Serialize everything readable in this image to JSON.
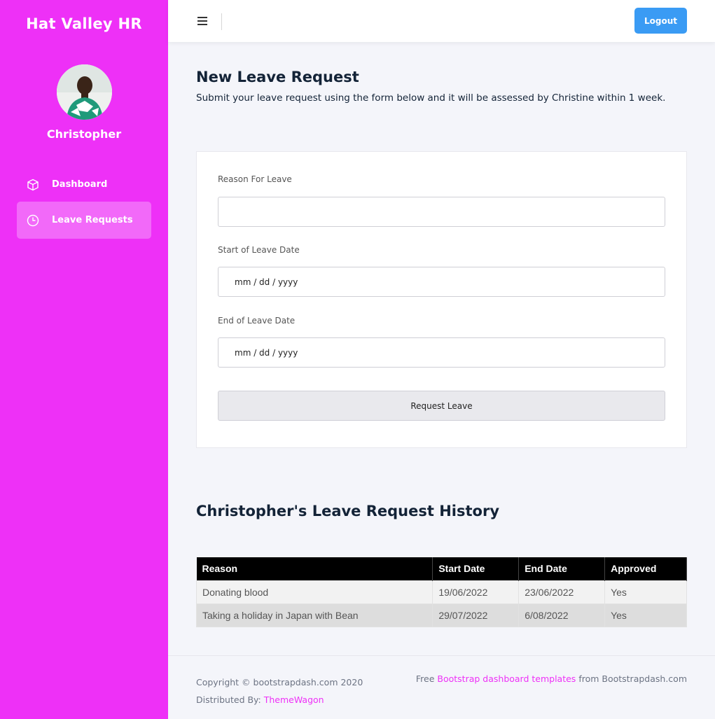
{
  "sidebar": {
    "brand": "Hat Valley HR",
    "user_name": "Christopher",
    "items": [
      {
        "label": "Dashboard",
        "icon": "cube-icon"
      },
      {
        "label": "Leave Requests",
        "icon": "clock-icon"
      }
    ],
    "colors": {
      "background": "#ee30f7"
    }
  },
  "topbar": {
    "logout_label": "Logout",
    "colors": {
      "logout_button": "#3a9bf4"
    }
  },
  "form": {
    "title": "New Leave Request",
    "subtitle": "Submit your leave request using the form below and it will be assessed by Christine within 1 week.",
    "reason_label": "Reason For Leave",
    "reason_value": "",
    "start_label": "Start of Leave Date",
    "start_placeholder": "mm / dd / yyyy",
    "end_label": "End of Leave Date",
    "end_placeholder": "mm / dd / yyyy",
    "submit_label": "Request Leave"
  },
  "history": {
    "title": "Christopher's Leave Request History",
    "columns": [
      "Reason",
      "Start Date",
      "End Date",
      "Approved"
    ],
    "rows": [
      [
        "Donating blood",
        "19/06/2022",
        "23/06/2022",
        "Yes"
      ],
      [
        "Taking a holiday in Japan with Bean",
        "29/07/2022",
        "6/08/2022",
        "Yes"
      ]
    ]
  },
  "footer": {
    "copyright": "Copyright © bootstrapdash.com 2020",
    "distributed_prefix": "Distributed By:",
    "distributed_link": "ThemeWagon",
    "free_prefix": "Free",
    "templates_link": "Bootstrap dashboard templates",
    "from_suffix": "from Bootstrapdash.com",
    "colors": {
      "link": "#ee30f7"
    }
  }
}
